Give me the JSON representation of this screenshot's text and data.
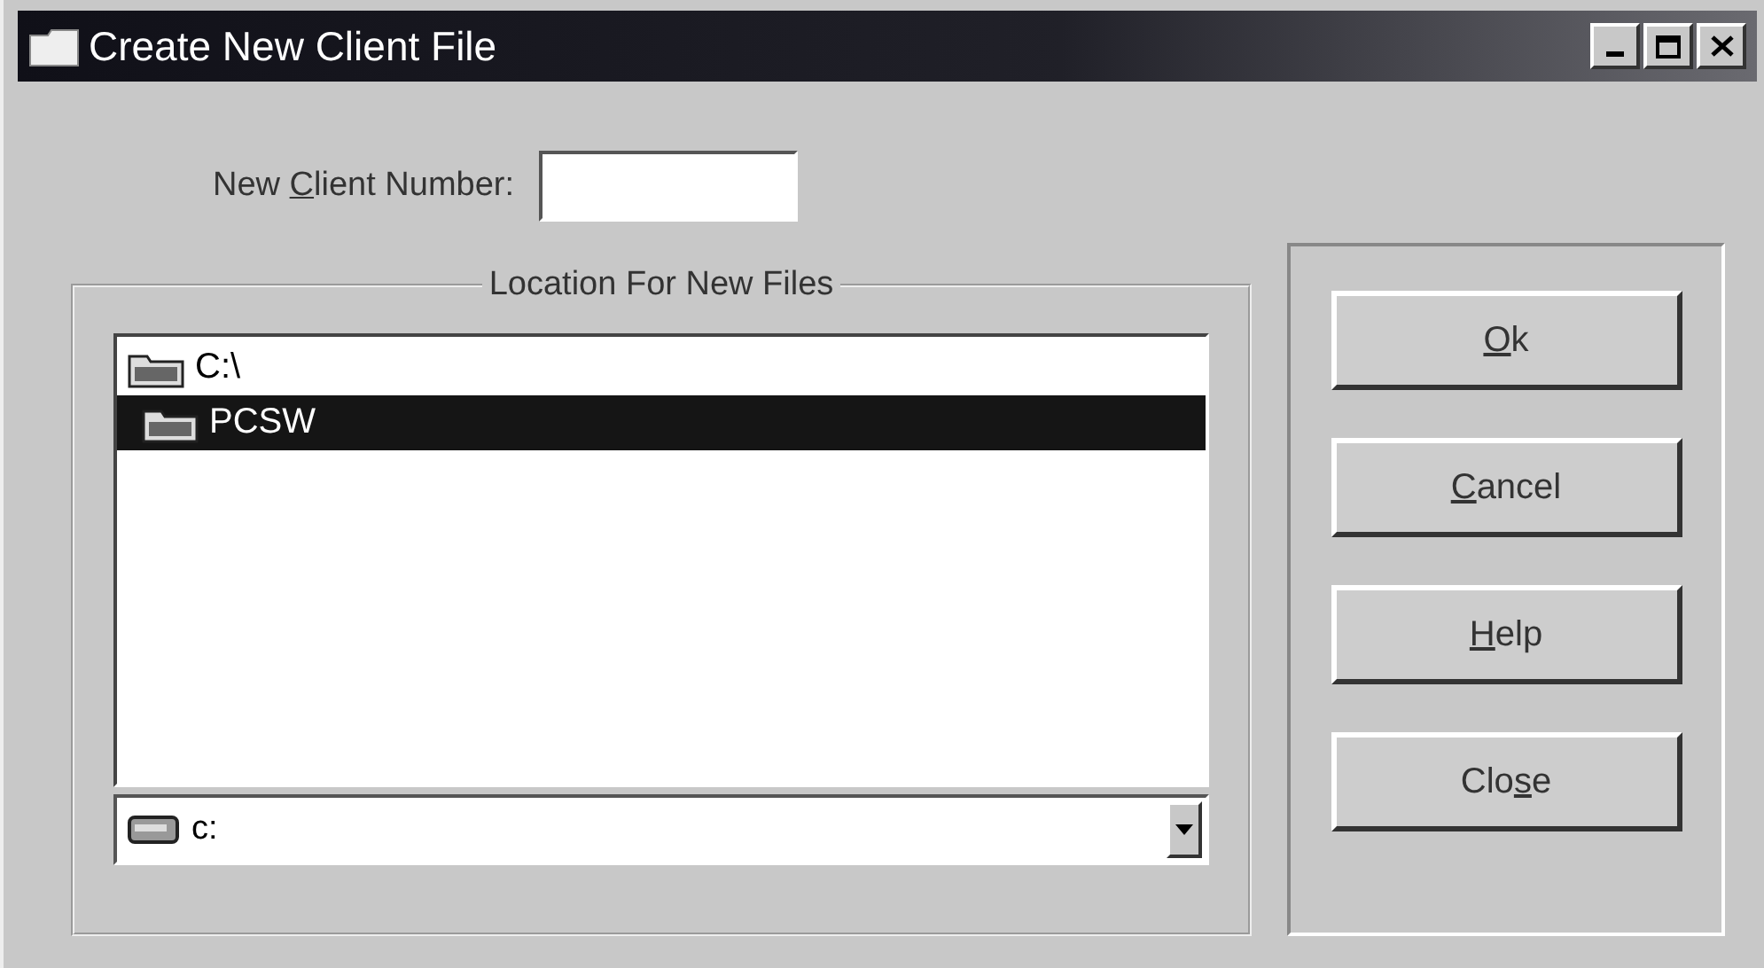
{
  "window": {
    "title": "Create New Client File",
    "controls": [
      {
        "kind": "minimize"
      },
      {
        "kind": "maximize"
      },
      {
        "kind": "close"
      }
    ]
  },
  "client_number": {
    "label": {
      "pre": "New ",
      "key": "C",
      "post": "lient Number:"
    }
  },
  "location": {
    "legend": "Location For New Files",
    "folders": [
      {
        "name": "C:\\",
        "selected": false,
        "children": [
          {
            "name": "PCSW",
            "selected": true
          }
        ]
      }
    ],
    "drive": {
      "value": "c:"
    }
  },
  "buttons": [
    {
      "label": {
        "key": "O",
        "post": "k"
      }
    },
    {
      "label": {
        "key": "C",
        "post": "ancel"
      }
    },
    {
      "label": {
        "key": "H",
        "post": "elp"
      }
    },
    {
      "label": {
        "pre": "Clo",
        "key": "s",
        "post": "e"
      }
    }
  ]
}
